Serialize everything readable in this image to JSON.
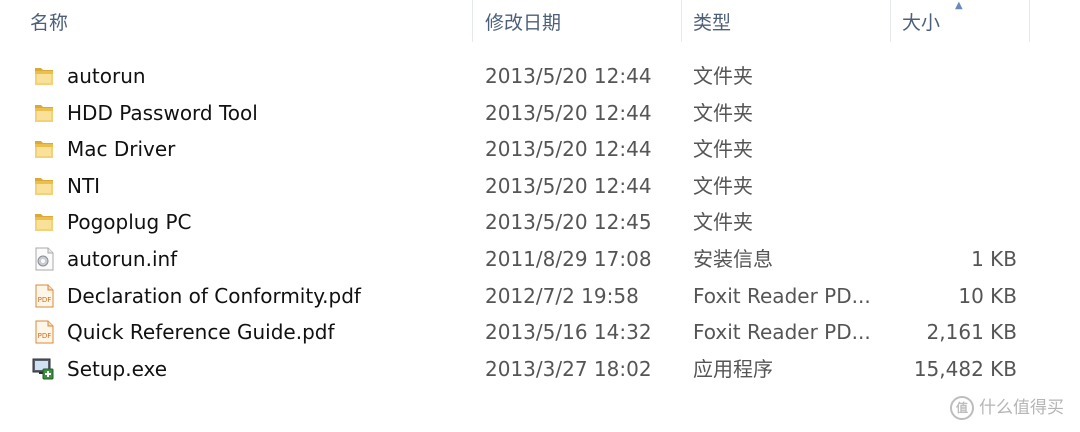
{
  "header": {
    "name": "名称",
    "date": "修改日期",
    "type": "类型",
    "size": "大小"
  },
  "files": [
    {
      "name": "autorun",
      "date": "2013/5/20 12:44",
      "type": "文件夹",
      "size": "",
      "icon": "folder-icon"
    },
    {
      "name": "HDD Password Tool",
      "date": "2013/5/20 12:44",
      "type": "文件夹",
      "size": "",
      "icon": "folder-icon"
    },
    {
      "name": "Mac Driver",
      "date": "2013/5/20 12:44",
      "type": "文件夹",
      "size": "",
      "icon": "folder-icon"
    },
    {
      "name": "NTI",
      "date": "2013/5/20 12:44",
      "type": "文件夹",
      "size": "",
      "icon": "folder-icon"
    },
    {
      "name": "Pogoplug PC",
      "date": "2013/5/20 12:45",
      "type": "文件夹",
      "size": "",
      "icon": "folder-icon"
    },
    {
      "name": "autorun.inf",
      "date": "2011/8/29 17:08",
      "type": "安装信息",
      "size": "1 KB",
      "icon": "settings-file-icon"
    },
    {
      "name": "Declaration of Conformity.pdf",
      "date": "2012/7/2 19:58",
      "type": "Foxit Reader PD...",
      "size": "10 KB",
      "icon": "pdf-icon"
    },
    {
      "name": "Quick Reference Guide.pdf",
      "date": "2013/5/16 14:32",
      "type": "Foxit Reader PD...",
      "size": "2,161 KB",
      "icon": "pdf-icon"
    },
    {
      "name": "Setup.exe",
      "date": "2013/3/27 18:02",
      "type": "应用程序",
      "size": "15,482 KB",
      "icon": "setup-icon"
    }
  ],
  "watermark": {
    "logo": "值",
    "text": "什么值得买"
  },
  "colors": {
    "header_text": "#4c607a",
    "folder": "#e8c35a",
    "pdf": "#e07b1f"
  }
}
